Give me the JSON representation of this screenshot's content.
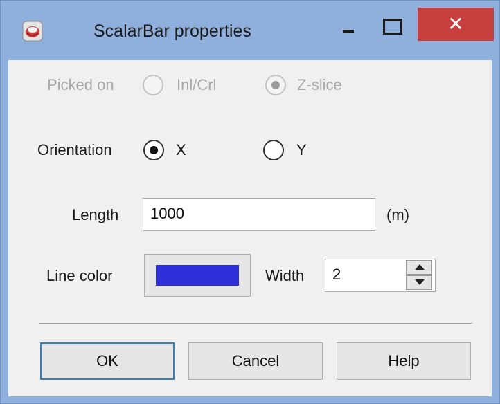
{
  "window": {
    "title": "ScalarBar properties",
    "icon": "app-logo-icon",
    "controls": {
      "minimize": "minimize-icon",
      "maximize": "maximize-icon",
      "close": "✕"
    },
    "colors": {
      "frame": "#8fb0dc",
      "close_button": "#c8403e",
      "client_background": "#f0f0f0"
    }
  },
  "picked_on": {
    "label": "Picked on",
    "enabled": false,
    "options": [
      {
        "label": "Inl/Crl",
        "selected": false
      },
      {
        "label": "Z-slice",
        "selected": true
      }
    ]
  },
  "orientation": {
    "label": "Orientation",
    "options": [
      {
        "label": "X",
        "selected": true
      },
      {
        "label": "Y",
        "selected": false
      }
    ]
  },
  "length": {
    "label": "Length",
    "value": "1000",
    "unit": "(m)"
  },
  "line_color": {
    "label": "Line color",
    "color": "#2f2fd9"
  },
  "width": {
    "label": "Width",
    "value": "2"
  },
  "buttons": {
    "ok": "OK",
    "cancel": "Cancel",
    "help": "Help"
  }
}
